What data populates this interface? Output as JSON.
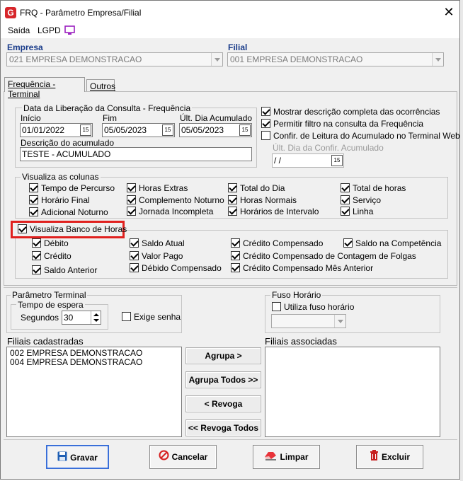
{
  "window": {
    "title": "FRQ - Parâmetro Empresa/Filial",
    "close": "✕"
  },
  "menu": {
    "saida": "Saída",
    "lgpd": "LGPD"
  },
  "empresa": {
    "label": "Empresa",
    "value": "021 EMPRESA DEMONSTRACAO"
  },
  "filial": {
    "label": "Filial",
    "value": "001 EMPRESA DEMONSTRACAO"
  },
  "tabs": [
    {
      "label": "Frequência - Terminal"
    },
    {
      "label": "Outros"
    }
  ],
  "liberacao": {
    "title": "Data da Liberação da Consulta  - Frequência",
    "inicio_label": "Início",
    "inicio_value": "01/01/2022",
    "fim_label": "Fim",
    "fim_value": "05/05/2023",
    "ult_label": "Últ. Dia Acumulado",
    "ult_value": "05/05/2023",
    "desc_label": "Descrição do acumulado",
    "desc_value": "TESTE - ACUMULADO",
    "cal_glyph": "15"
  },
  "options": {
    "mostrar": "Mostrar descrição completa das ocorrências",
    "permitir": "Permitir filtro na consulta da Frequência",
    "confir": "Confir. de Leitura do Acumulado no Terminal Web",
    "confir_date_label": "Últ. Dia da Confir. Acumulado",
    "confir_date_value": " / /"
  },
  "colunas": {
    "title": "Visualiza as colunas",
    "items": [
      "Tempo de Percurso",
      "Horas Extras",
      "Total do Dia",
      "Total de horas",
      "Horário Final",
      "Complemento Noturno",
      "Horas Normais",
      "Serviço",
      "Adicional Noturno",
      "Jornada Incompleta",
      "Horários de Intervalo",
      "Linha"
    ]
  },
  "banco": {
    "title": "Visualiza Banco de Horas",
    "items": [
      "Débito",
      "Saldo Atual",
      "Crédito Compensado",
      "Saldo na Competência",
      "Crédito",
      "Valor Pago",
      "Crédito Compensado de Contagem de Folgas",
      "Saldo Anterior",
      "Débido Compensado",
      "Crédito Compensado Mês Anterior"
    ]
  },
  "terminal": {
    "title": "Parâmetro Terminal",
    "espera_title": "Tempo de espera",
    "segundos_label": "Segundos",
    "segundos_value": "30",
    "exige_senha": "Exige senha"
  },
  "fuso": {
    "title": "Fuso Horário",
    "utiliza": "Utiliza fuso horário"
  },
  "filiais": {
    "cadastradas_label": "Filiais cadastradas",
    "cadastradas": [
      "002 EMPRESA DEMONSTRACAO",
      "004 EMPRESA DEMONSTRACAO"
    ],
    "associadas_label": "Filiais associadas"
  },
  "buttons": {
    "agrupa": "Agrupa >",
    "agrupa_todos": "Agrupa Todos >>",
    "revoga": "< Revoga",
    "revoga_todos": "<< Revoga Todos",
    "gravar": "Gravar",
    "cancelar": "Cancelar",
    "limpar": "Limpar",
    "excluir": "Excluir"
  },
  "colors": {
    "accent_blue": "#1a3c8a",
    "highlight_red": "#e0201e",
    "lgpd_purple": "#9b1fbf"
  }
}
